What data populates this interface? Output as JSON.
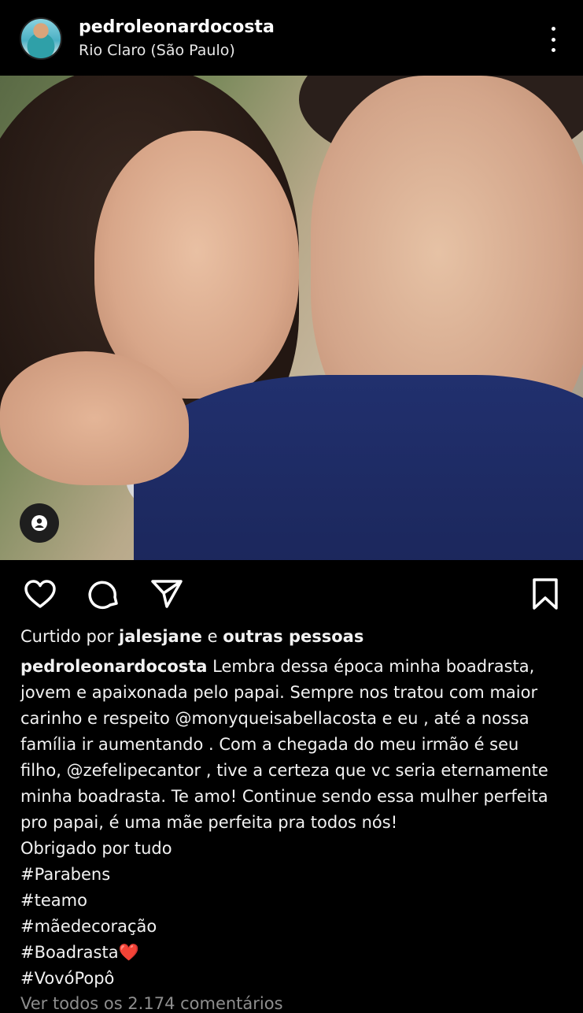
{
  "post": {
    "username": "pedroleonardocosta",
    "location": "Rio Claro (São Paulo)",
    "liked_by_prefix": "Curtido por",
    "liked_by_user": "jalesjane",
    "liked_by_joiner": " e ",
    "liked_by_others": "outras pessoas",
    "caption_lines": [
      "Lembra dessa época minha boadrasta,",
      "jovem e apaixonada pelo papai. Sempre nos tratou com maior",
      "carinho e respeito @monyqueisabellacosta e eu , até a nossa",
      "família ir aumentando . Com a chegada do meu irmão é seu",
      "filho, @zefelipecantor , tive a certeza que vc seria eternamente",
      "minha boadrasta. Te amo! Continue sendo essa mulher perfeita",
      "pro papai, é uma mãe perfeita pra todos nós!",
      "Obrigado por tudo",
      "#Parabens",
      "#teamo",
      "#mãedecoração",
      "#Boadrasta❤️",
      "#VovóPopô"
    ],
    "comments_link": "Ver todos os 2.174 comentários"
  },
  "icons": {
    "avatar": "profile-avatar",
    "more": "more-vertical-icon",
    "tag": "user-tag-icon",
    "like": "heart-icon",
    "comment": "comment-icon",
    "share": "send-icon",
    "save": "bookmark-icon"
  },
  "colors": {
    "background": "#000000",
    "text": "#f5f5f5",
    "muted": "#8e8e8e"
  }
}
